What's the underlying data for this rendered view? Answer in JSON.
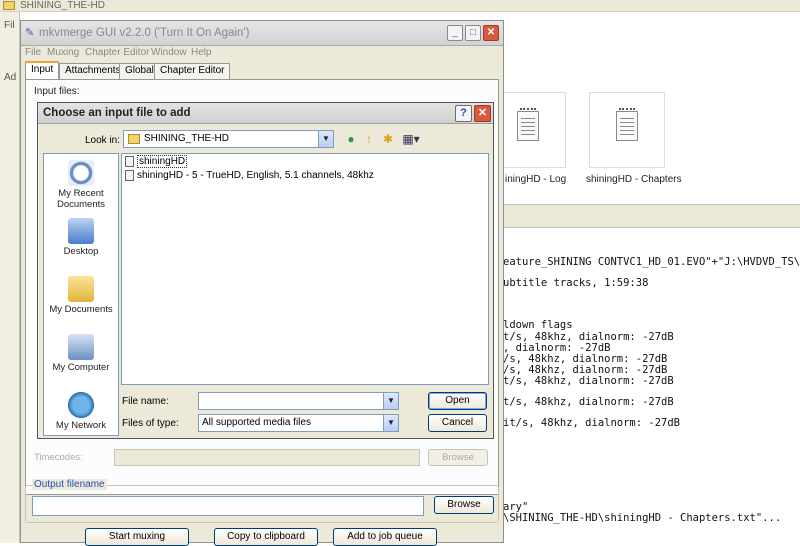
{
  "explorer": {
    "title": "SHINING_THE-HD",
    "left_fragments": [
      "Fil",
      "Ad"
    ],
    "files": [
      {
        "caption": "iningHD - Log"
      },
      {
        "caption": "shiningHD - Chapters"
      }
    ],
    "log_lines": [
      "eature_SHINING CONTVC1_HD_01.EVO\"+\"J:\\HVDVD_TS\\",
      "ubtitle tracks, 1:59:38",
      "ldown flags",
      "t/s, 48khz, dialnorm: -27dB",
      ", dialnorm: -27dB",
      "/s, 48khz, dialnorm: -27dB",
      "/s, 48khz, dialnorm: -27dB",
      "t/s, 48khz, dialnorm: -27dB",
      "t/s, 48khz, dialnorm: -27dB",
      "it/s, 48khz, dialnorm: -27dB",
      "ary\"",
      "\\SHINING_THE-HD\\shiningHD - Chapters.txt\"..."
    ]
  },
  "mkvmerge": {
    "title": "mkvmerge GUI v2.2.0 ('Turn It On Again')",
    "menu": [
      "File",
      "Muxing",
      "Chapter Editor",
      "Window",
      "Help"
    ],
    "tabs": [
      "Input",
      "Attachments",
      "Global",
      "Chapter Editor"
    ],
    "input_files_label": "Input files:",
    "timecodes_label": "Timecodes:",
    "timecodes_browse": "Browse",
    "output_legend": "Output filename",
    "output_browse": "Browse",
    "buttons": {
      "start_muxing": "Start muxing",
      "copy_clipboard": "Copy to clipboard",
      "add_job": "Add to job queue"
    }
  },
  "dialog": {
    "title": "Choose an input file to add",
    "help_glyph": "?",
    "close_glyph": "✕",
    "look_in_label": "Look in:",
    "look_in_value": "SHINING_THE-HD",
    "places": [
      "My Recent Documents",
      "Desktop",
      "My Documents",
      "My Computer",
      "My Network"
    ],
    "files": [
      "shiningHD",
      "shiningHD - 5 - TrueHD, English, 5.1 channels, 48khz"
    ],
    "file_name_label": "File name:",
    "file_name_value": "",
    "file_type_label": "Files of type:",
    "file_type_value": "All supported media files",
    "open_button": "Open",
    "cancel_button": "Cancel"
  }
}
